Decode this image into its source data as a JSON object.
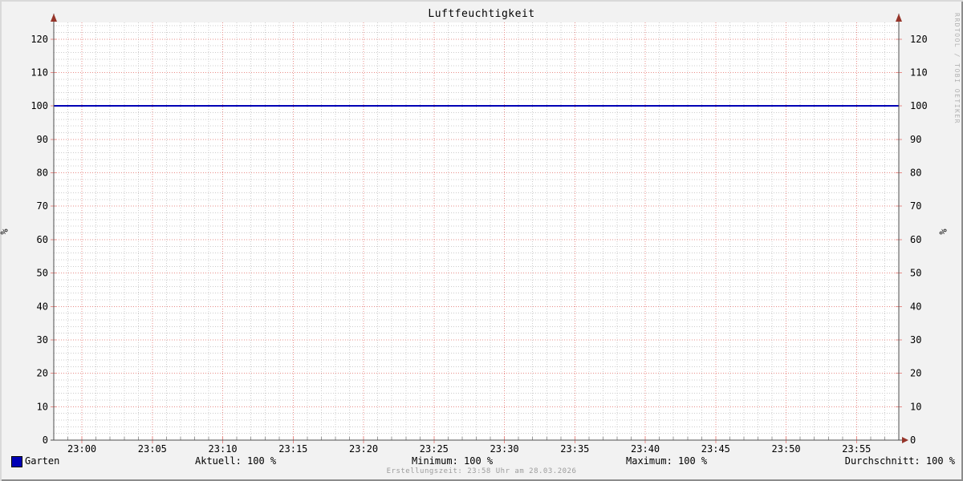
{
  "title": "Luftfeuchtigkeit",
  "watermark": "RRDTOOL / TOBI OETIKER",
  "footer": "Erstellungszeit: 23:58 Uhr am 28.03.2026",
  "y_axis_unit": "%",
  "legend": {
    "series_label": "Garten",
    "stats": [
      {
        "name": "aktuell",
        "text": "Aktuell: 100 %"
      },
      {
        "name": "minimum",
        "text": "Minimum: 100 %"
      },
      {
        "name": "maximum",
        "text": "Maximum: 100 %"
      },
      {
        "name": "durchschnitt",
        "text": "Durchschnitt: 100 %"
      }
    ]
  },
  "colors": {
    "background": "#f2f2f2",
    "canvas": "#ffffff",
    "axis": "#4f4f4f",
    "arrow": "#96352a",
    "grid_major": "#e88c88",
    "grid_minor": "#cccccc",
    "minor_tick": "#999999",
    "series": "#0000b6",
    "text": "#000000",
    "footer_text": "#9c9c9c",
    "watermark_text": "#b2b2b2"
  },
  "chart_data": {
    "type": "line",
    "title": "Luftfeuchtigkeit",
    "xlabel": "",
    "ylabel": "%",
    "ylim": [
      0,
      125
    ],
    "y_ticks": [
      0,
      10,
      20,
      30,
      40,
      50,
      60,
      70,
      80,
      90,
      100,
      110,
      120
    ],
    "x_range": [
      "22:58",
      "23:58"
    ],
    "x_ticks": [
      "23:00",
      "23:05",
      "23:10",
      "23:15",
      "23:20",
      "23:25",
      "23:30",
      "23:35",
      "23:40",
      "23:45",
      "23:50",
      "23:55"
    ],
    "grid": true,
    "legend_position": "bottom-left",
    "series": [
      {
        "name": "Garten",
        "color": "#0000b6",
        "value": 100
      }
    ],
    "stats": {
      "aktuell": 100,
      "minimum": 100,
      "maximum": 100,
      "durchschnitt": 100,
      "unit": "%"
    }
  }
}
